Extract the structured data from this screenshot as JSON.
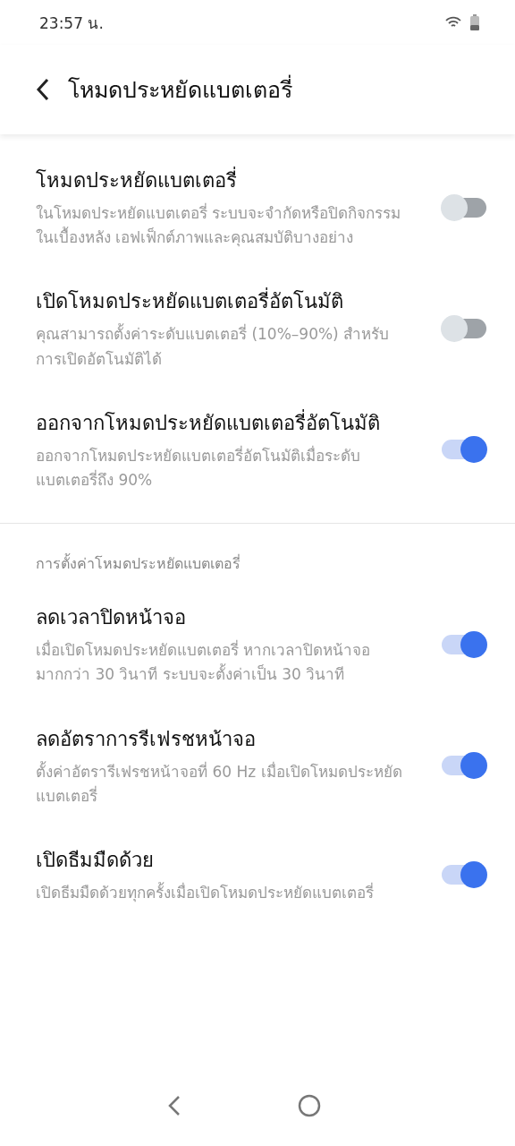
{
  "status_bar": {
    "time": "23:57 น."
  },
  "header": {
    "title": "โหมดประหยัดแบตเตอรี่"
  },
  "sections": [
    {
      "items": [
        {
          "title": "โหมดประหยัดแบตเตอรี่",
          "description": "ในโหมดประหยัดแบตเตอรี่ ระบบจะจำกัดหรือปิดกิจกรรมในเบื้องหลัง เอฟเฟ็กต์ภาพและคุณสมบัติบางอย่าง",
          "on": false
        },
        {
          "title": "เปิดโหมดประหยัดแบตเตอรี่อัตโนมัติ",
          "description": "คุณสามารถตั้งค่าระดับแบตเตอรี่ (10%–90%) สำหรับการเปิดอัตโนมัติได้",
          "on": false
        },
        {
          "title": "ออกจากโหมดประหยัดแบตเตอรี่อัตโนมัติ",
          "description": "ออกจากโหมดประหยัดแบตเตอรี่อัตโนมัติเมื่อระดับแบตเตอรี่ถึง 90%",
          "on": true
        }
      ]
    },
    {
      "heading": "การตั้งค่าโหมดประหยัดแบตเตอรี่",
      "items": [
        {
          "title": "ลดเวลาปิดหน้าจอ",
          "description": "เมื่อเปิดโหมดประหยัดแบตเตอรี่ หากเวลาปิดหน้าจอมากกว่า 30 วินาที ระบบจะตั้งค่าเป็น 30 วินาที",
          "on": true
        },
        {
          "title": "ลดอัตราการรีเฟรชหน้าจอ",
          "description": "ตั้งค่าอัตรารีเฟรชหน้าจอที่ 60 Hz เมื่อเปิดโหมดประหยัดแบตเตอรี่",
          "on": true
        },
        {
          "title": "เปิดธีมมืดด้วย",
          "description": "เปิดธีมมืดด้วยทุกครั้งเมื่อเปิดโหมดประหยัดแบตเตอรี่",
          "on": true
        }
      ]
    }
  ]
}
